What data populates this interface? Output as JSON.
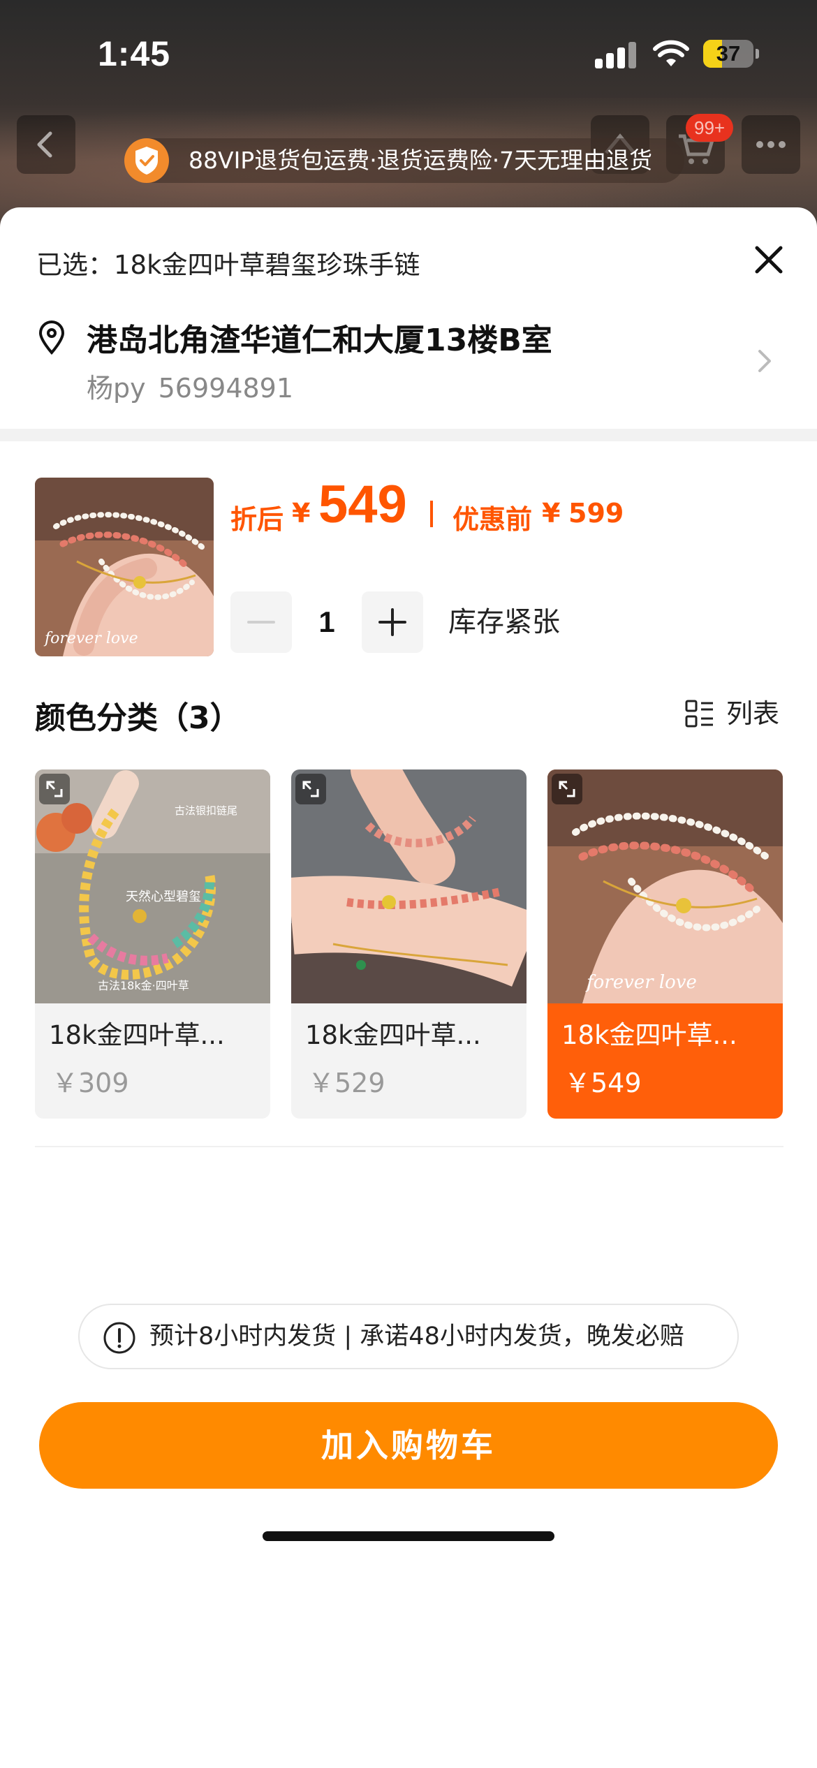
{
  "status_bar": {
    "time": "1:45",
    "battery": "37",
    "battery_level": 0.37
  },
  "top_nav": {
    "cart_badge": "99+"
  },
  "vip_banner": {
    "text": "88VIP退货包运费·退货运费险·7天无理由退货"
  },
  "sheet": {
    "selected_text": "已选：18k金四叶草碧玺珍珠手链",
    "address": {
      "line": "港岛北角渣华道仁和大厦13楼B室",
      "name": "杨py",
      "phone": "56994891"
    },
    "price": {
      "discount_label": "折后",
      "currency": "¥",
      "amount": "549",
      "original_label": "优惠前",
      "original_amount": "599"
    },
    "quantity": {
      "value": "1",
      "stock_status": "库存紧张"
    },
    "variants_section": {
      "title": "颜色分类（3）",
      "view_label": "列表",
      "items": [
        {
          "name": "18k金四叶草...",
          "price": "￥309",
          "selected": false,
          "img_caption_1": "天然心型碧玺",
          "img_caption_2": "古法18k金·四叶草",
          "img_caption_3": "古法银扣链尾"
        },
        {
          "name": "18k金四叶草...",
          "price": "￥529",
          "selected": false
        },
        {
          "name": "18k金四叶草...",
          "price": "￥549",
          "selected": true,
          "img_caption_1": "forever love"
        }
      ]
    },
    "thumb_caption": "forever love",
    "shipping_note": "预计8小时内发货 | 承诺48小时内发货，晚发必赔",
    "add_to_cart": "加入购物车"
  },
  "colors": {
    "accent": "#ff5500",
    "button": "#ff8a00",
    "selected_card": "#ff5f0a"
  }
}
